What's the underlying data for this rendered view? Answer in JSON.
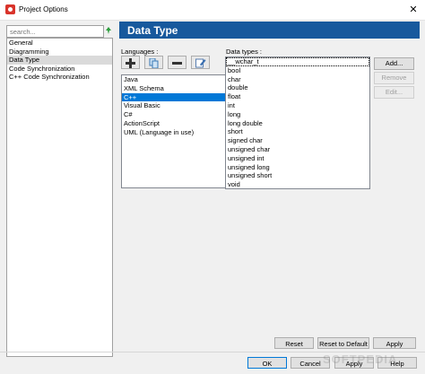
{
  "window": {
    "title": "Project Options"
  },
  "sidebar": {
    "search_placeholder": "search...",
    "items": [
      {
        "label": "General"
      },
      {
        "label": "Diagramming"
      },
      {
        "label": "Data Type"
      },
      {
        "label": "Code Synchronization"
      },
      {
        "label": "C++ Code Synchronization"
      }
    ],
    "selected_index": 2
  },
  "panel": {
    "title": "Data Type",
    "languages_label": "Languages :",
    "datatypes_label": "Data types :",
    "languages": [
      {
        "label": "Java"
      },
      {
        "label": "XML Schema"
      },
      {
        "label": "C++"
      },
      {
        "label": "Visual Basic"
      },
      {
        "label": "C#"
      },
      {
        "label": "ActionScript"
      },
      {
        "label": "UML   (Language in use)"
      }
    ],
    "selected_language_index": 2,
    "data_types": [
      {
        "label": "__wchar_t"
      },
      {
        "label": "bool"
      },
      {
        "label": "char"
      },
      {
        "label": "double"
      },
      {
        "label": "float"
      },
      {
        "label": "int"
      },
      {
        "label": "long"
      },
      {
        "label": "long double"
      },
      {
        "label": "short"
      },
      {
        "label": "signed char"
      },
      {
        "label": "unsigned char"
      },
      {
        "label": "unsigned int"
      },
      {
        "label": "unsigned long"
      },
      {
        "label": "unsigned short"
      },
      {
        "label": "void"
      }
    ],
    "side_buttons": {
      "add": "Add...",
      "remove": "Remove",
      "edit": "Edit..."
    },
    "bottom_buttons": {
      "reset": "Reset",
      "reset_default": "Reset to Default",
      "apply": "Apply"
    }
  },
  "dialog_buttons": {
    "ok": "OK",
    "cancel": "Cancel",
    "apply": "Apply",
    "help": "Help"
  },
  "watermark": "SOFTPEDIA",
  "colors": {
    "header": "#17599d",
    "selection": "#0078d7"
  }
}
